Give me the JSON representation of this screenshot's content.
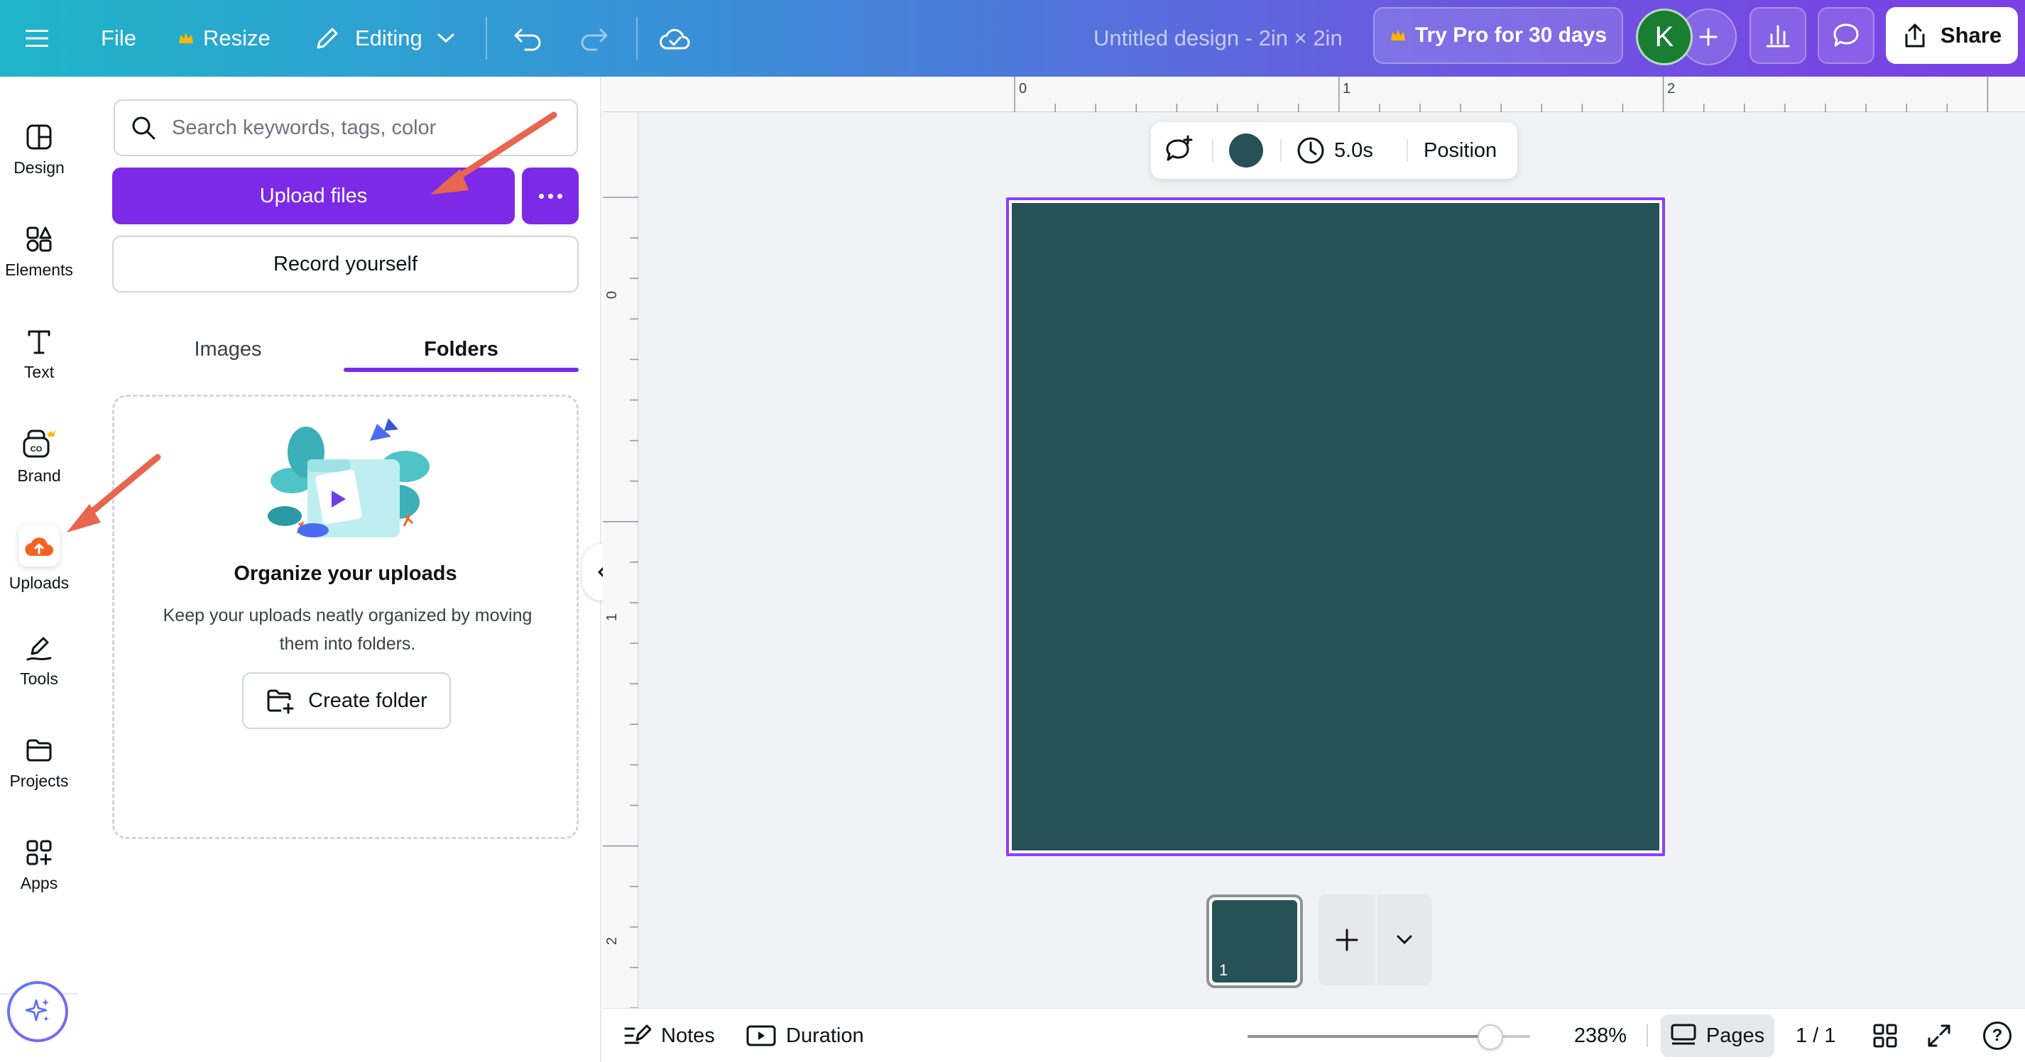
{
  "topbar": {
    "menu_icon": "hamburger-menu-icon",
    "file_label": "File",
    "resize_label": "Resize",
    "editing_label": "Editing",
    "design_title": "Untitled design - 2in × 2in",
    "try_pro_label": "Try Pro for 30 days",
    "avatar_initial": "K",
    "share_label": "Share",
    "colors": {
      "crown": "#ffb400",
      "avatar": "#1a7e32"
    }
  },
  "rail": {
    "items": [
      {
        "label": "Design",
        "icon": "design-icon"
      },
      {
        "label": "Elements",
        "icon": "elements-icon"
      },
      {
        "label": "Text",
        "icon": "text-icon"
      },
      {
        "label": "Brand",
        "icon": "brand-icon"
      },
      {
        "label": "Uploads",
        "icon": "uploads-icon"
      },
      {
        "label": "Tools",
        "icon": "tools-icon"
      },
      {
        "label": "Projects",
        "icon": "projects-icon"
      },
      {
        "label": "Apps",
        "icon": "apps-icon"
      }
    ],
    "active": "Uploads",
    "magic_icon": "magic-sparkle-icon"
  },
  "panel": {
    "search_placeholder": "Search keywords, tags, color",
    "upload_label": "Upload files",
    "record_label": "Record yourself",
    "tabs": [
      {
        "label": "Images"
      },
      {
        "label": "Folders"
      }
    ],
    "active_tab": "Folders",
    "empty_title": "Organize your uploads",
    "empty_description": "Keep your uploads neatly organized by moving them into folders.",
    "create_folder_label": "Create folder",
    "accent_color": "#7d2ae8"
  },
  "workspace": {
    "ruler_h": [
      "0",
      "1",
      "2"
    ],
    "ruler_v": [
      "0",
      "1",
      "2"
    ],
    "toolbar": {
      "duration": "5.0s",
      "position_label": "Position",
      "swatch_color": "#255157"
    },
    "canvas_color": "#255157",
    "page_number": "1"
  },
  "bottombar": {
    "notes_label": "Notes",
    "duration_label": "Duration",
    "zoom": "238%",
    "zoom_fraction": 0.86,
    "pages_label": "Pages",
    "page_count": "1 / 1",
    "help_label": "?"
  }
}
